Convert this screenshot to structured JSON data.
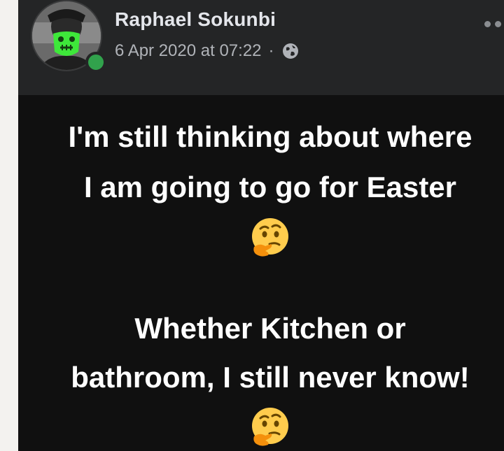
{
  "post": {
    "author_name": "Raphael Sokunbi",
    "timestamp": "6 Apr 2020 at 07:22",
    "separator": "·",
    "privacy_icon": "globe-icon",
    "menu_icon": "more-options-icon",
    "body_lines": [
      "I'm still thinking about where",
      "I am going to go for Easter",
      "Whether Kitchen or",
      "bathroom, I still never know!"
    ],
    "emoji_icon": "thinking-face-emoji"
  },
  "colors": {
    "header_bg": "#242526",
    "body_bg": "#101010",
    "name_text": "#e4e6eb",
    "meta_text": "#b0b3b8",
    "online_green": "#31a24c",
    "mask_green": "#3ee83a"
  }
}
